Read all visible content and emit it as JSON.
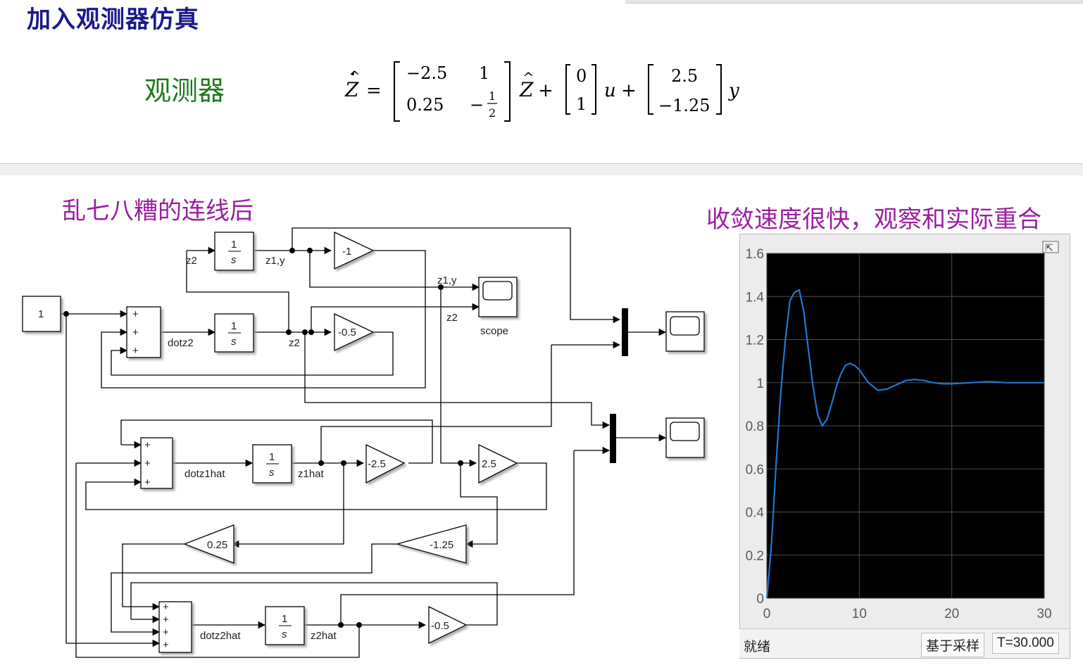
{
  "slide": {
    "title": "加入观测器仿真",
    "observer_label": "观测器",
    "left_caption": "乱七八糟的连线后",
    "right_caption": "收敛速度很快，观察和实际重合"
  },
  "equation": {
    "A": [
      [
        "−2.5",
        "1"
      ],
      [
        "0.25",
        "−"
      ]
    ],
    "half_num": "1",
    "half_den": "2",
    "B": [
      "0",
      "1"
    ],
    "L": [
      "2.5",
      "−1.25"
    ]
  },
  "diagram": {
    "const_value": "1",
    "integrator_num": "1",
    "integrator_den": "s",
    "plus": "+",
    "gains": {
      "g_m1": "-1",
      "g_m05": "-0.5",
      "g_m25": "-2.5",
      "g_25": "2.5",
      "g_m125": "-1.25",
      "g_025": "0.25",
      "g_m05b": "-0.5"
    },
    "labels": {
      "z2_in": "z2",
      "z1y": "z1,y",
      "dotz2": "dotz2",
      "z2": "z2",
      "scope_z1y": "z1,y",
      "scope_z2": "z2",
      "scope": "scope",
      "dotz1hat": "dotz1hat",
      "z1hat": "z1hat",
      "dotz2hat": "dotz2hat",
      "z2hat": "z2hat"
    }
  },
  "scope_window": {
    "background": "#000000",
    "grid_color": "#4d4d4d",
    "line_color": "#1f77d0",
    "status_ready": "就绪",
    "status_sample": "基于采样",
    "status_time": "T=30.000"
  },
  "chart_data": {
    "type": "line",
    "xlim": [
      0,
      30
    ],
    "ylim": [
      0,
      1.6
    ],
    "x_ticks": [
      "0",
      "10",
      "20",
      "30"
    ],
    "y_ticks": [
      "0",
      "0.2",
      "0.4",
      "0.6",
      "0.8",
      "1",
      "1.2",
      "1.4",
      "1.6"
    ],
    "grid": true,
    "series": [
      {
        "x": [
          0,
          0.5,
          1,
          1.5,
          2,
          2.5,
          3,
          3.5,
          4,
          4.5,
          5,
          5.5,
          6,
          6.5,
          7,
          7.5,
          8,
          8.5,
          9,
          9.5,
          10,
          10.5,
          11,
          12,
          13,
          14,
          15,
          16,
          17,
          18,
          19,
          20,
          22,
          24,
          26,
          28,
          30
        ],
        "y": [
          0,
          0.25,
          0.62,
          0.95,
          1.2,
          1.38,
          1.42,
          1.43,
          1.33,
          1.15,
          0.98,
          0.85,
          0.8,
          0.83,
          0.9,
          0.98,
          1.04,
          1.08,
          1.09,
          1.08,
          1.06,
          1.03,
          1.0,
          0.965,
          0.97,
          0.99,
          1.01,
          1.015,
          1.01,
          1.0,
          0.995,
          0.995,
          1.0,
          1.005,
          1.0,
          1.0,
          1.0
        ]
      }
    ]
  }
}
